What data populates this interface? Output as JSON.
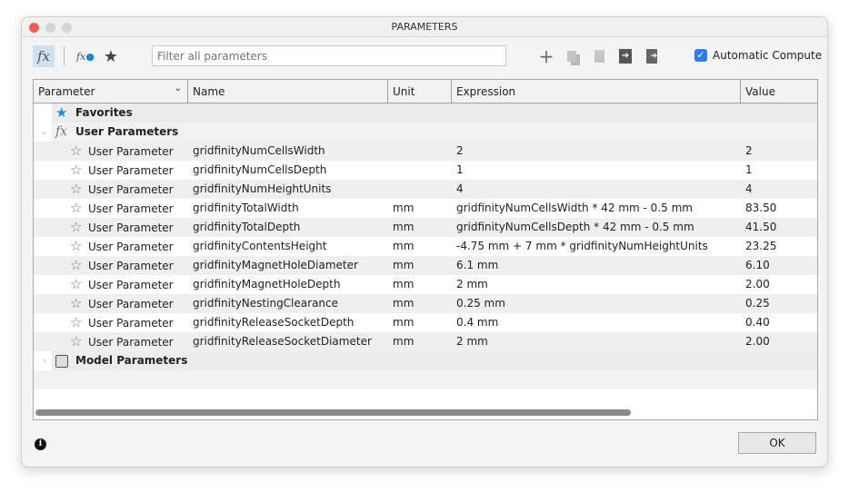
{
  "window": {
    "title": "PARAMETERS"
  },
  "toolbar": {
    "filter_placeholder": "Filter all parameters",
    "auto_compute_label": "Automatic Compute",
    "auto_compute_checked": true
  },
  "columns": [
    "Parameter",
    "Name",
    "Unit",
    "Expression",
    "Value"
  ],
  "groups": {
    "favorites": "Favorites",
    "user": "User Parameters",
    "model": "Model Parameters"
  },
  "rows": [
    {
      "type": "User Parameter",
      "name": "gridfinityNumCellsWidth",
      "unit": "",
      "expression": "2",
      "value": "2"
    },
    {
      "type": "User Parameter",
      "name": "gridfinityNumCellsDepth",
      "unit": "",
      "expression": "1",
      "value": "1"
    },
    {
      "type": "User Parameter",
      "name": "gridfinityNumHeightUnits",
      "unit": "",
      "expression": "4",
      "value": "4"
    },
    {
      "type": "User Parameter",
      "name": "gridfinityTotalWidth",
      "unit": "mm",
      "expression": "gridfinityNumCellsWidth * 42 mm - 0.5 mm",
      "value": "83.50"
    },
    {
      "type": "User Parameter",
      "name": "gridfinityTotalDepth",
      "unit": "mm",
      "expression": "gridfinityNumCellsDepth * 42 mm - 0.5 mm",
      "value": "41.50"
    },
    {
      "type": "User Parameter",
      "name": "gridfinityContentsHeight",
      "unit": "mm",
      "expression": "-4.75 mm + 7 mm * gridfinityNumHeightUnits",
      "value": "23.25"
    },
    {
      "type": "User Parameter",
      "name": "gridfinityMagnetHoleDiameter",
      "unit": "mm",
      "expression": "6.1 mm",
      "value": "6.10"
    },
    {
      "type": "User Parameter",
      "name": "gridfinityMagnetHoleDepth",
      "unit": "mm",
      "expression": "2 mm",
      "value": "2.00"
    },
    {
      "type": "User Parameter",
      "name": "gridfinityNestingClearance",
      "unit": "mm",
      "expression": "0.25 mm",
      "value": "0.25"
    },
    {
      "type": "User Parameter",
      "name": "gridfinityReleaseSocketDepth",
      "unit": "mm",
      "expression": "0.4 mm",
      "value": "0.40"
    },
    {
      "type": "User Parameter",
      "name": "gridfinityReleaseSocketDiameter",
      "unit": "mm",
      "expression": "2 mm",
      "value": "2.00"
    }
  ],
  "footer": {
    "ok_label": "OK"
  }
}
